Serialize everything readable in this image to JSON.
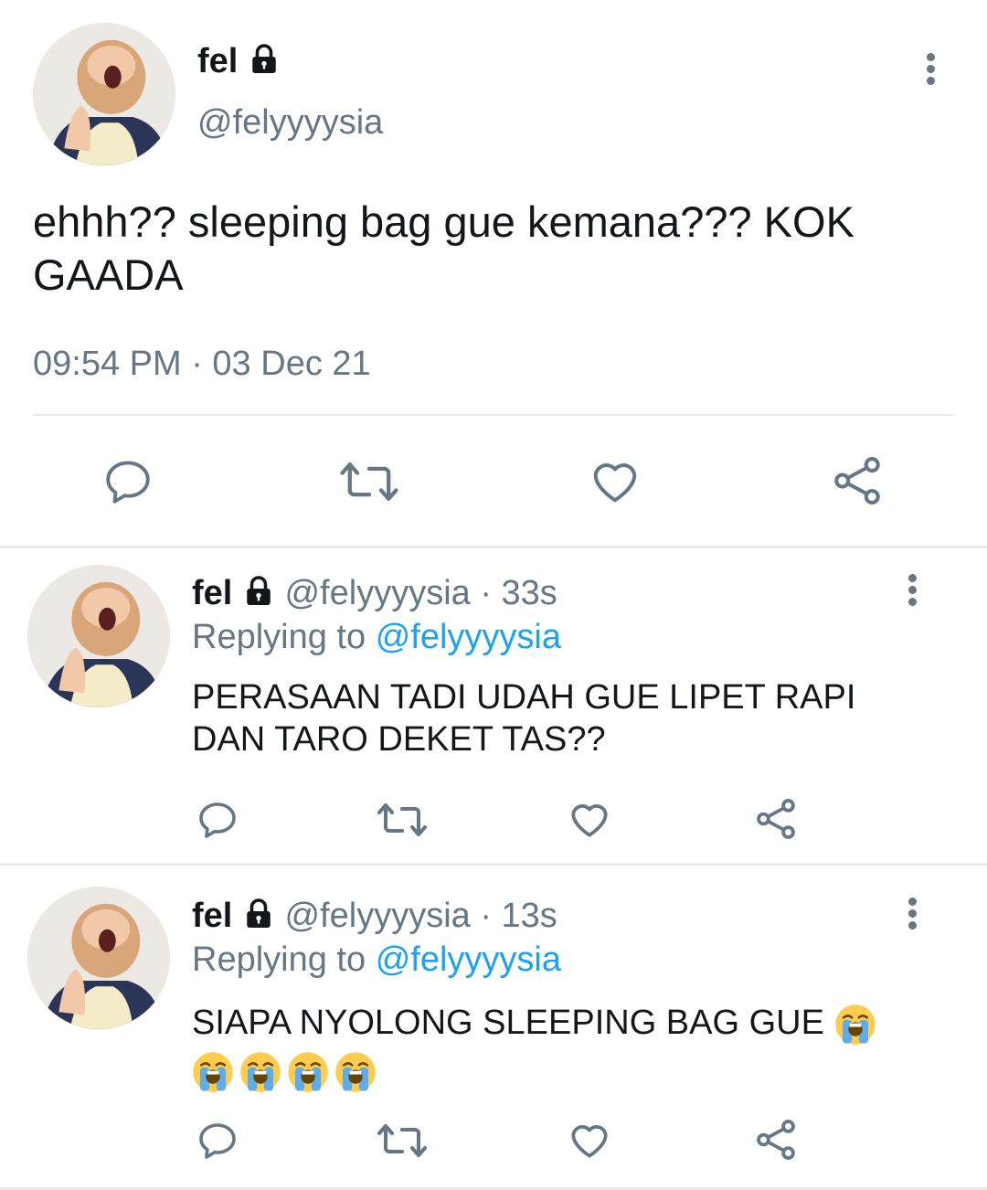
{
  "main_tweet": {
    "display_name": "fel",
    "handle": "@felyyyysia",
    "text_line1": "ehhh?? sleeping bag gue kemana??? KOK",
    "text_line2": "GAADA",
    "timestamp": "09:54 PM · 03 Dec 21"
  },
  "replies": [
    {
      "display_name": "fel",
      "handle_time": "@felyyyysia · 33s",
      "replying_prefix": "Replying to",
      "replying_to": "@felyyyysia",
      "text_line1": "PERASAAN TADI UDAH GUE LIPET RAPI",
      "text_line2": "DAN TARO DEKET TAS??"
    },
    {
      "display_name": "fel",
      "handle_time": "@felyyyysia · 13s",
      "replying_prefix": "Replying to",
      "replying_to": "@felyyyysia",
      "text_line1": "SIAPA NYOLONG SLEEPING BAG GUE",
      "emoji": "loudly-crying-face",
      "emoji_count": 5
    }
  ],
  "icons": [
    "lock-icon",
    "more-vertical-icon",
    "reply-icon",
    "retweet-icon",
    "like-icon",
    "share-icon",
    "avatar"
  ],
  "colors": {
    "text": "#14171a",
    "muted": "#657786",
    "link": "#1da1f2",
    "divider": "#e6ecf0"
  }
}
